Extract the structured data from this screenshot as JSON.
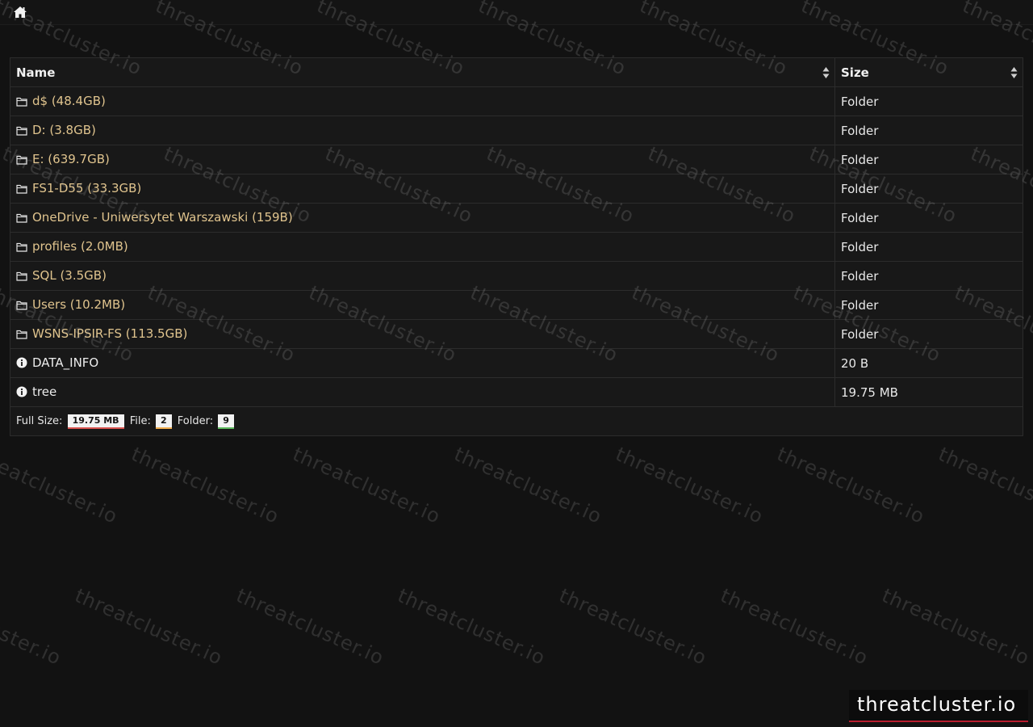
{
  "nav": {
    "home_icon": "home-icon"
  },
  "table": {
    "headers": {
      "name": "Name",
      "size": "Size"
    },
    "rows": [
      {
        "icon": "folder-icon",
        "name": "d$ (48.4GB)",
        "size": "Folder"
      },
      {
        "icon": "folder-icon",
        "name": "D: (3.8GB)",
        "size": "Folder"
      },
      {
        "icon": "folder-icon",
        "name": "E: (639.7GB)",
        "size": "Folder"
      },
      {
        "icon": "folder-icon",
        "name": "FS1-D55 (33.3GB)",
        "size": "Folder"
      },
      {
        "icon": "folder-icon",
        "name": "OneDrive - Uniwersytet Warszawski (159B)",
        "size": "Folder"
      },
      {
        "icon": "folder-icon",
        "name": "profiles (2.0MB)",
        "size": "Folder"
      },
      {
        "icon": "folder-icon",
        "name": "SQL (3.5GB)",
        "size": "Folder"
      },
      {
        "icon": "folder-icon",
        "name": "Users (10.2MB)",
        "size": "Folder"
      },
      {
        "icon": "folder-icon",
        "name": "WSNS-IPSIR-FS (113.5GB)",
        "size": "Folder"
      },
      {
        "icon": "info-icon",
        "name": "DATA_INFO",
        "size": "20 B"
      },
      {
        "icon": "info-icon",
        "name": "tree",
        "size": "19.75 MB"
      }
    ],
    "footer": {
      "full_size_label": "Full Size:",
      "full_size_value": "19.75 MB",
      "file_label": "File:",
      "file_count": "2",
      "folder_label": "Folder:",
      "folder_count": "9"
    }
  },
  "watermark": {
    "text": "threatcluster.io"
  },
  "brand": {
    "text": "threatcluster.io",
    "accent": "#b81d2e"
  },
  "colors": {
    "background": "#121212",
    "link": "#e0c48e"
  }
}
